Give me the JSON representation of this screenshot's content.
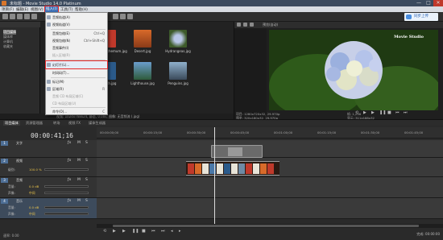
{
  "window": {
    "title": "未标题 - Movie Studio 14.0 Platinum",
    "controls": [
      "—",
      "□",
      "✕"
    ]
  },
  "menubar": {
    "items": [
      "项目(F)",
      "编辑(E)",
      "视图(V)",
      "插入(I)",
      "工具(T)",
      "帮助(H)"
    ],
    "active_index": 3
  },
  "cloud_button": {
    "label": "同步上传"
  },
  "explorer": {
    "tree": [
      "项目媒体",
      "媒体库",
      "计算机",
      "收藏夹"
    ],
    "selected_index": 0,
    "thumbnails": [
      {
        "label": "Chrysanthemum.jpg",
        "color": "#c0392b"
      },
      {
        "label": "Desert.jpg",
        "color": "#c8562a"
      },
      {
        "label": "Hydrangeas.jpg",
        "color": "#6a7f3a"
      },
      {
        "label": "Jellyfish.jpg",
        "color": "#2b5a8a"
      },
      {
        "label": "Lighthouse.jpg",
        "color": "#4a78a8"
      },
      {
        "label": "Penguins.jpg",
        "color": "#6e8aa4"
      }
    ],
    "status": "视频: 1024x768x24, 静态, 0.00s; 图像: 无音频流 (.jpg)"
  },
  "insert_menu": {
    "items": [
      {
        "label": "音频轨道(A)",
        "shortcut": "",
        "disabled": false
      },
      {
        "label": "视频轨道(V)",
        "shortcut": "",
        "disabled": false
      },
      {
        "label": "音频包络(E)",
        "shortcut": "Ctrl+Q",
        "disabled": false
      },
      {
        "label": "视频包络(N)",
        "shortcut": "Ctrl+Shift+Q",
        "disabled": false
      },
      {
        "label": "音频事件(I)",
        "shortcut": "",
        "disabled": false
      },
      {
        "label": "插入区域(R)",
        "shortcut": "",
        "disabled": true
      },
      {
        "label": "幻灯片(L)...",
        "shortcut": "",
        "disabled": false,
        "highlight": true
      },
      {
        "label": "时间码(T)...",
        "shortcut": "",
        "disabled": false
      },
      {
        "label": "标记(M)",
        "shortcut": "",
        "disabled": false
      },
      {
        "label": "区域(R)",
        "shortcut": "R",
        "disabled": false
      },
      {
        "label": "音频 CD 布局区域(C)",
        "shortcut": "",
        "disabled": true
      },
      {
        "label": "CD 布局区域(U)",
        "shortcut": "",
        "disabled": true
      },
      {
        "label": "命令(O)...",
        "shortcut": "C",
        "disabled": false
      }
    ]
  },
  "preview": {
    "toolbar_label": "预览(自动)",
    "watermark": "Movie Studio",
    "info_left": [
      "项目: 1280x720x32, 29.970p",
      "预览: 320x180x32, 29.970p"
    ],
    "info_right": [
      "帧: 1,246",
      "显示: 311x188x32"
    ]
  },
  "tabs": {
    "items": [
      "项目媒体",
      "资源管理器",
      "转场",
      "视频 FX",
      "媒体生成器"
    ],
    "active_index": 0
  },
  "timeline": {
    "timecode": "00:00:41;16",
    "ruler": [
      "00:00:00;00",
      "00:00:15;00",
      "00:00:30;00",
      "00:00:45;00",
      "00:01:00;00",
      "00:01:15;00",
      "00:01:30;00",
      "00:01:45;00"
    ],
    "tracks": [
      {
        "num": "1",
        "name": "文字",
        "sub": []
      },
      {
        "num": "2",
        "name": "视频",
        "sub": [
          {
            "label": "级别:",
            "value": "100.0 %"
          }
        ]
      },
      {
        "num": "3",
        "name": "音频",
        "sub": [
          {
            "label": "音量:",
            "value": "0.0 dB"
          },
          {
            "label": "声像:",
            "value": "中间"
          }
        ]
      },
      {
        "num": "4",
        "name": "音乐",
        "sub": [
          {
            "label": "音量:",
            "value": "0.0 dB"
          },
          {
            "label": "声像:",
            "value": "中间"
          }
        ]
      }
    ],
    "rate_label": "速率: 0.00",
    "status": "完成: 00:00:00"
  }
}
